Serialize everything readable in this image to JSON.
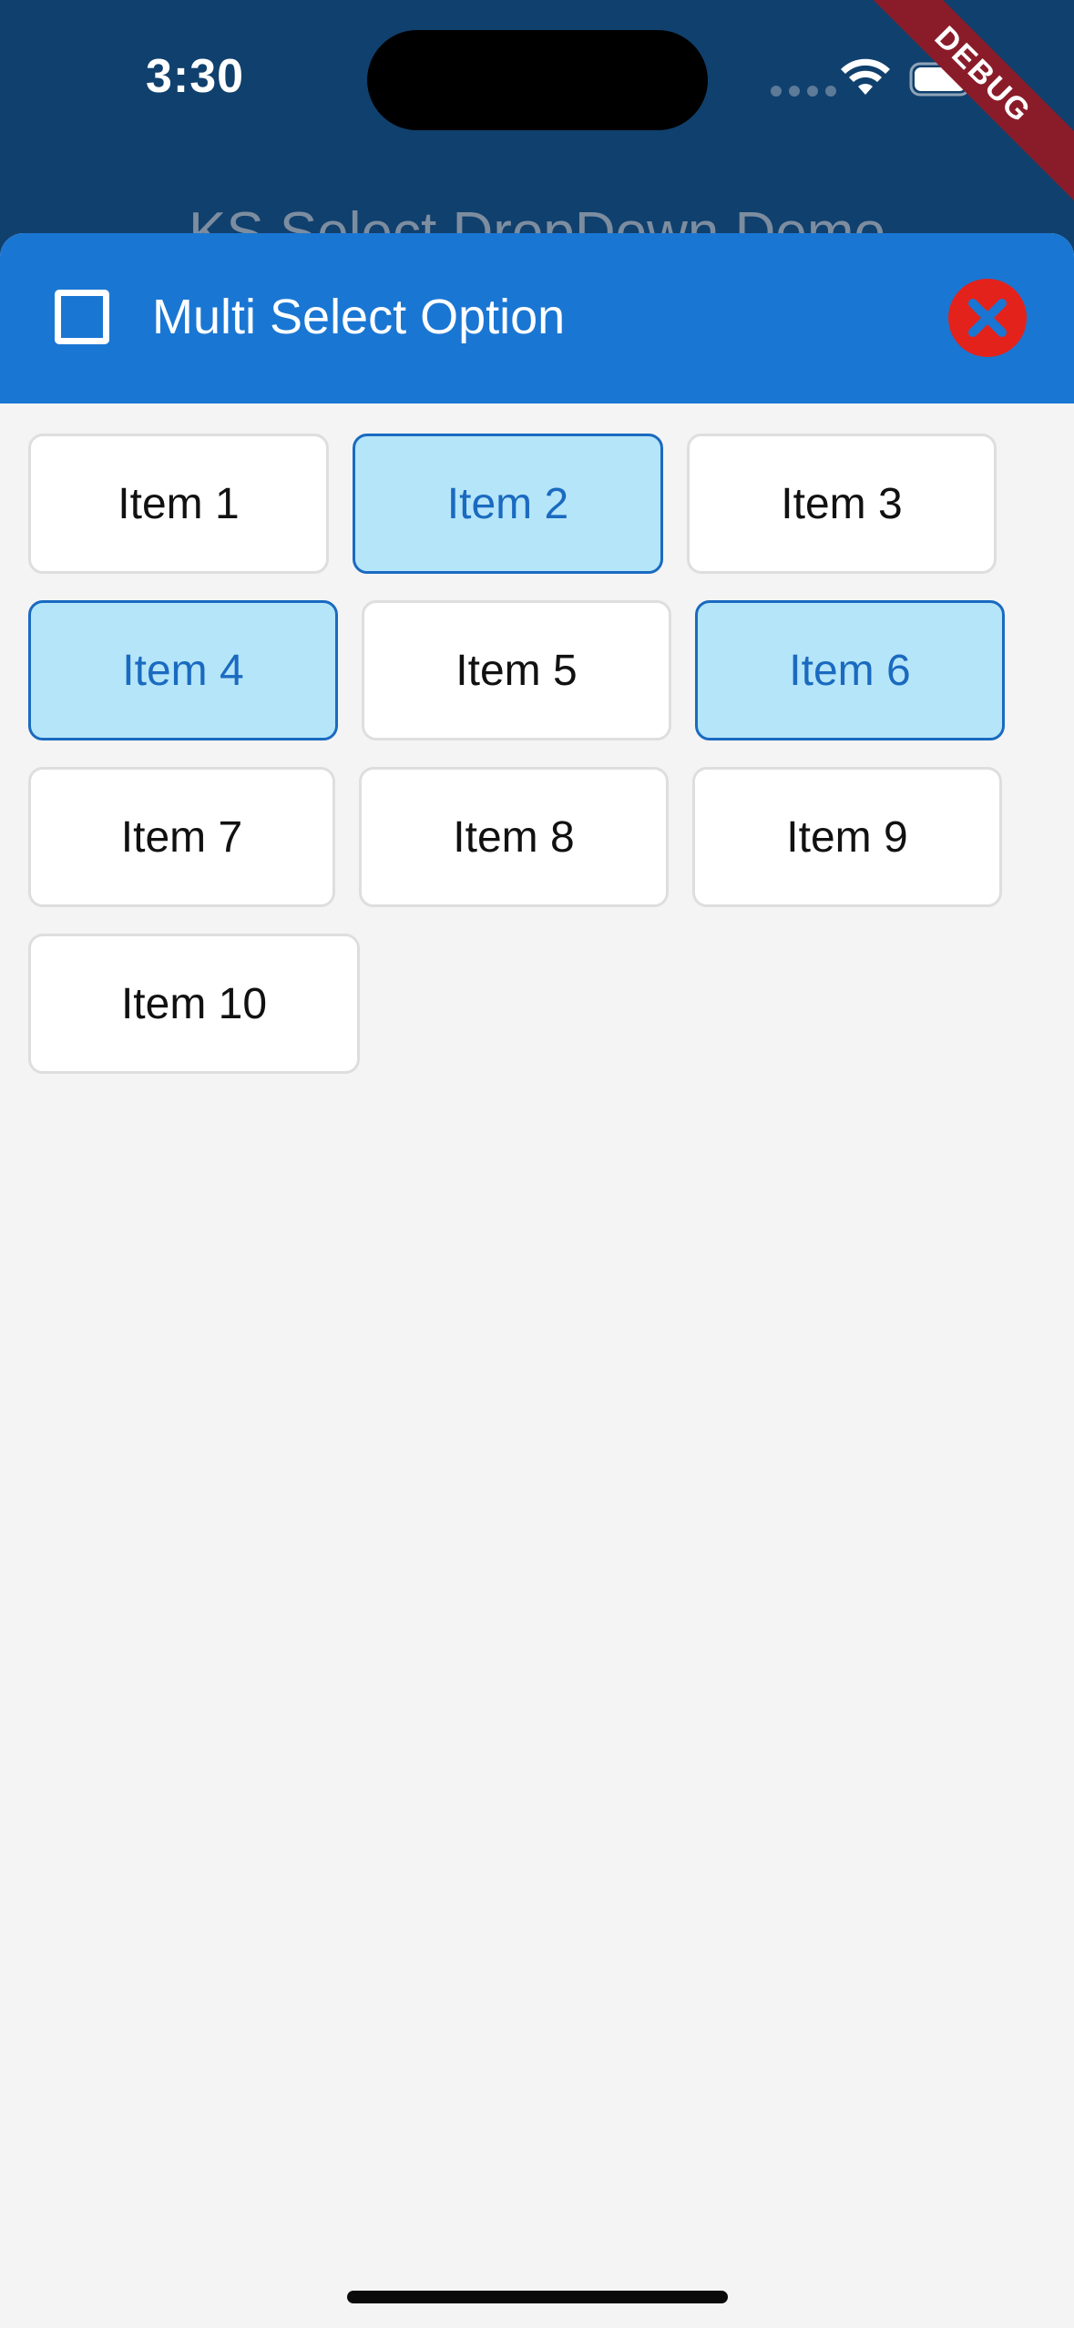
{
  "status_bar": {
    "time": "3:30",
    "debug_label": "DEBUG"
  },
  "background": {
    "app_title": "KS Select DropDown Demo"
  },
  "sheet": {
    "title": "Multi Select Option",
    "select_all_checked": false,
    "close_icon": "close-icon",
    "colors": {
      "header": "#1a76d3",
      "selected_fill": "#b5e5f9",
      "selected_text": "#1a6ac0",
      "close": "#e3221b"
    }
  },
  "items": [
    {
      "label": "Item 1",
      "selected": false
    },
    {
      "label": "Item 2",
      "selected": true
    },
    {
      "label": "Item 3",
      "selected": false
    },
    {
      "label": "Item 4",
      "selected": true
    },
    {
      "label": "Item 5",
      "selected": false
    },
    {
      "label": "Item 6",
      "selected": true
    },
    {
      "label": "Item 7",
      "selected": false
    },
    {
      "label": "Item 8",
      "selected": false
    },
    {
      "label": "Item 9",
      "selected": false
    },
    {
      "label": "Item 10",
      "selected": false
    }
  ]
}
